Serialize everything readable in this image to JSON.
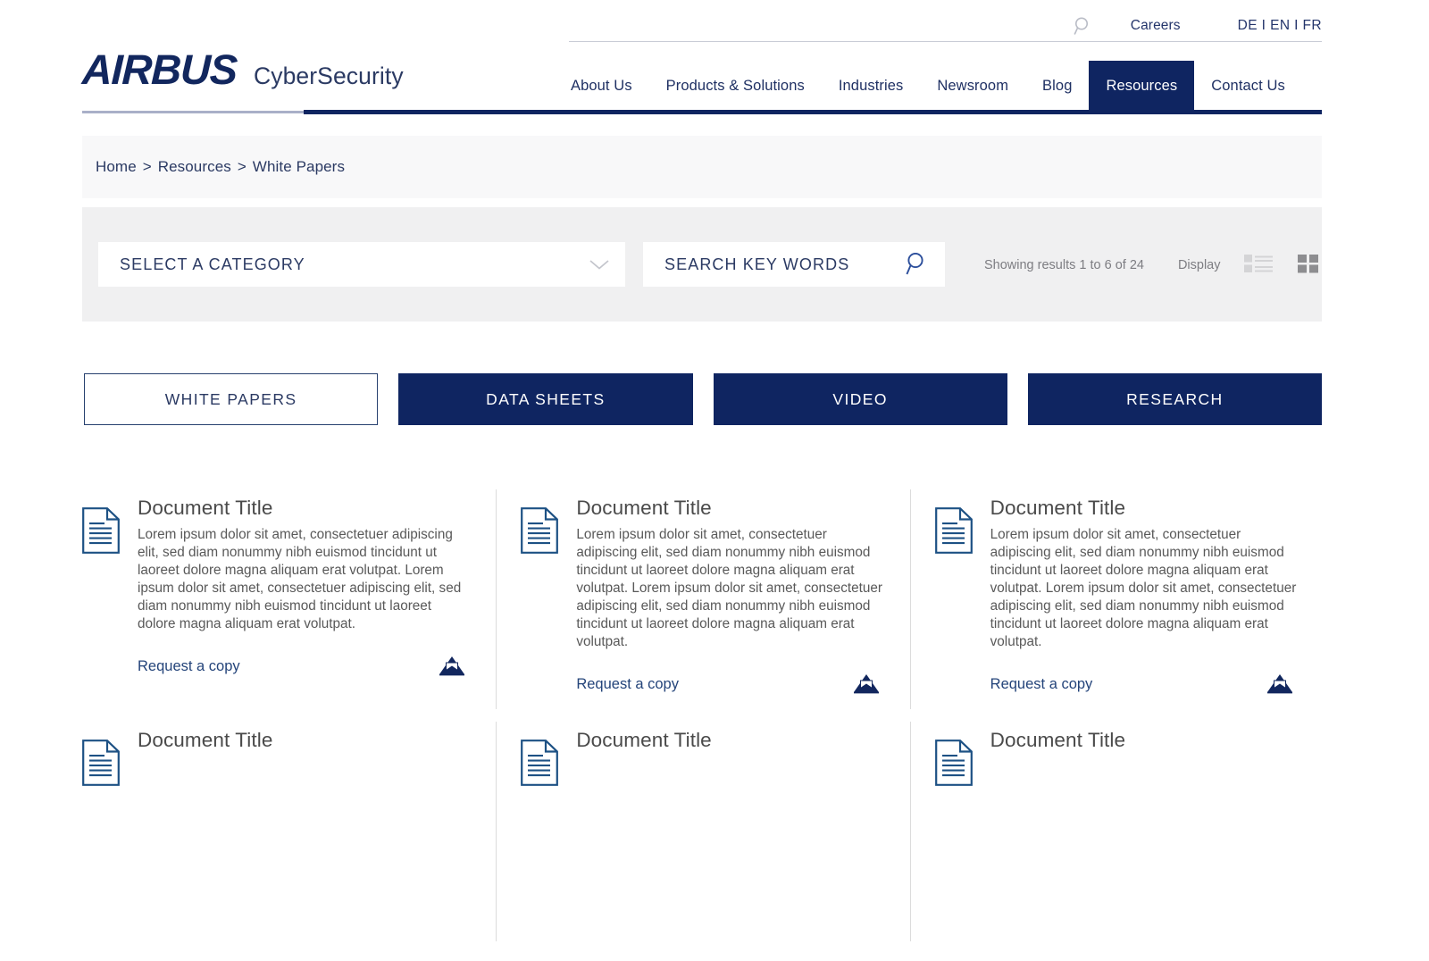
{
  "brand": {
    "logo_primary": "AIRBUS",
    "logo_secondary": "CyberSecurity",
    "navy": "#0f2561",
    "link_blue": "#24447a"
  },
  "header": {
    "search_icon": "search-icon",
    "careers_label": "Careers",
    "language_label": "DE I EN I FR",
    "nav": [
      {
        "label": "About Us",
        "active": false
      },
      {
        "label": "Products & Solutions",
        "active": false
      },
      {
        "label": "Industries",
        "active": false
      },
      {
        "label": "Newsroom",
        "active": false
      },
      {
        "label": "Blog",
        "active": false
      },
      {
        "label": "Resources",
        "active": true
      },
      {
        "label": "Contact Us",
        "active": false
      }
    ]
  },
  "breadcrumb": {
    "items": [
      "Home",
      "Resources",
      "White Papers"
    ],
    "separator": ">"
  },
  "filters": {
    "category_select": {
      "value": "SELECT A CATEGORY",
      "icon": "chevron-down-icon"
    },
    "search": {
      "placeholder": "SEARCH KEY WORDS",
      "value": "",
      "icon": "search-icon"
    },
    "results_text": "Showing results 1 to 6 of 24",
    "display_label": "Display",
    "views": [
      {
        "name": "list-view",
        "selected": false
      },
      {
        "name": "grid-view",
        "selected": true
      }
    ]
  },
  "category_tabs": [
    {
      "label": "WHITE PAPERS",
      "selected": true
    },
    {
      "label": "DATA SHEETS",
      "selected": false
    },
    {
      "label": "VIDEO",
      "selected": false
    },
    {
      "label": "RESEARCH",
      "selected": false
    }
  ],
  "cards": [
    {
      "title": "Document Title",
      "text": "Lorem ipsum dolor sit amet, consectetuer adipiscing elit, sed diam nonummy nibh euismod tincidunt ut laoreet dolore magna aliquam erat volutpat. Lorem ipsum dolor sit amet, consectetuer adipiscing elit, sed diam nonummy nibh euismod tincidunt ut laoreet dolore magna aliquam erat volutpat.",
      "link": "Request a copy"
    },
    {
      "title": "Document Title",
      "text": "Lorem ipsum dolor sit amet, consectetuer adipiscing elit, sed diam nonummy nibh euismod tincidunt ut laoreet dolore magna aliquam erat volutpat. Lorem ipsum dolor sit amet, consectetuer adipiscing elit, sed diam nonummy nibh euismod tincidunt ut laoreet dolore magna aliquam erat volutpat.",
      "link": "Request a copy"
    },
    {
      "title": "Document Title",
      "text": "Lorem ipsum dolor sit amet, consectetuer adipiscing elit, sed diam nonummy nibh euismod tincidunt ut laoreet dolore magna aliquam erat volutpat. Lorem ipsum dolor sit amet, consectetuer adipiscing elit, sed diam nonummy nibh euismod tincidunt ut laoreet dolore magna aliquam erat volutpat.",
      "link": "Request a copy"
    },
    {
      "title": "Document Title",
      "text": "",
      "link": ""
    },
    {
      "title": "Document Title",
      "text": "",
      "link": ""
    },
    {
      "title": "Document Title",
      "text": "",
      "link": ""
    }
  ]
}
